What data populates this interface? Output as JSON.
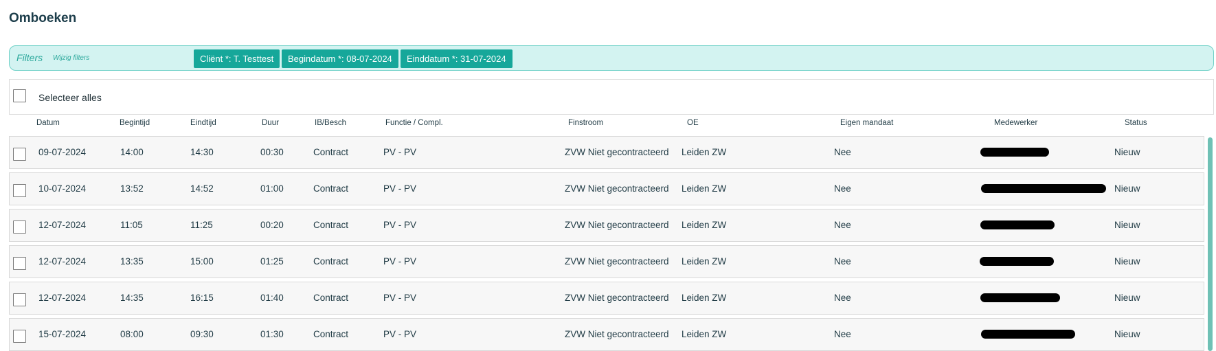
{
  "page": {
    "title": "Omboeken"
  },
  "filters": {
    "label": "Filters",
    "edit_link": "Wijzig filters",
    "chips": [
      "Cliënt *: T. Testtest",
      "Begindatum *: 08-07-2024",
      "Einddatum *: 31-07-2024"
    ]
  },
  "select_all": {
    "label": "Selecteer alles"
  },
  "table": {
    "columns": [
      "Datum",
      "Begintijd",
      "Eindtijd",
      "Duur",
      "IB/Besch",
      "Functie / Compl.",
      "Finstroom",
      "OE",
      "Eigen mandaat",
      "Medewerker",
      "Status"
    ],
    "rows": [
      [
        "09-07-2024",
        "14:00",
        "14:30",
        "00:30",
        "Contract",
        "PV - PV",
        "ZVW Niet gecontracteerd",
        "Leiden ZW",
        "Nee",
        "",
        "Nieuw"
      ],
      [
        "10-07-2024",
        "13:52",
        "14:52",
        "01:00",
        "Contract",
        "PV - PV",
        "ZVW Niet gecontracteerd",
        "Leiden ZW",
        "Nee",
        "",
        "Nieuw"
      ],
      [
        "12-07-2024",
        "11:05",
        "11:25",
        "00:20",
        "Contract",
        "PV - PV",
        "ZVW Niet gecontracteerd",
        "Leiden ZW",
        "Nee",
        "",
        "Nieuw"
      ],
      [
        "12-07-2024",
        "13:35",
        "15:00",
        "01:25",
        "Contract",
        "PV - PV",
        "ZVW Niet gecontracteerd",
        "Leiden ZW",
        "Nee",
        "",
        "Nieuw"
      ],
      [
        "12-07-2024",
        "14:35",
        "16:15",
        "01:40",
        "Contract",
        "PV - PV",
        "ZVW Niet gecontracteerd",
        "Leiden ZW",
        "Nee",
        "",
        "Nieuw"
      ],
      [
        "15-07-2024",
        "08:00",
        "09:30",
        "01:30",
        "Contract",
        "PV - PV",
        "ZVW Niet gecontracteerd",
        "Leiden ZW",
        "Nee",
        "",
        "Nieuw"
      ]
    ]
  },
  "colors": {
    "accent": "#16a79a",
    "filter_bg": "#d3f3f1",
    "filter_border": "#6fd1c7",
    "row_bg": "#f7f7f7"
  }
}
